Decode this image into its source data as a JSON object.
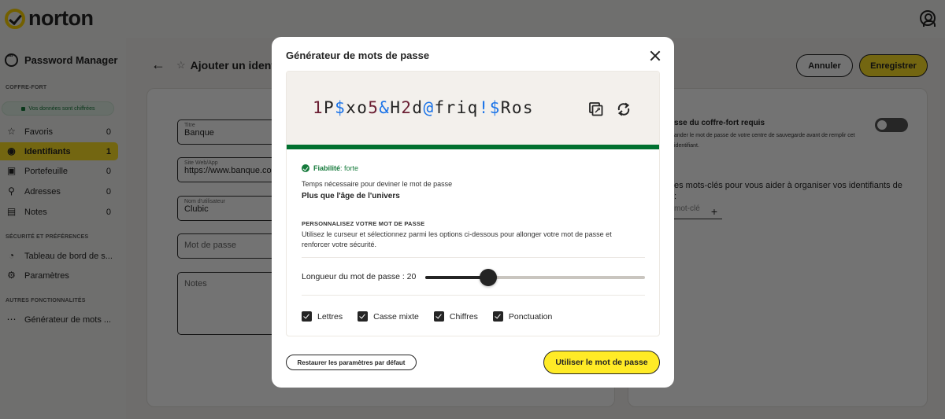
{
  "app": {
    "brand": "norton",
    "icons": {
      "logo": "norton-check-logo",
      "account": "account-circle-icon"
    }
  },
  "sidebar": {
    "title": "Password Manager",
    "sections": {
      "vault": "COFFRE-FORT",
      "security": "SÉCURITÉ ET PRÉFÉRENCES",
      "other": "AUTRES FONCTIONNALITÉS"
    },
    "encrypted_badge": "Vos données sont chiffrées",
    "vault_items": [
      {
        "label": "Favoris",
        "count": "0",
        "icon": "star-icon"
      },
      {
        "label": "Identifiants",
        "count": "1",
        "icon": "user-circle-icon",
        "active": true
      },
      {
        "label": "Portefeuille",
        "count": "0",
        "icon": "wallet-icon"
      },
      {
        "label": "Adresses",
        "count": "0",
        "icon": "location-pin-icon"
      },
      {
        "label": "Notes",
        "count": "0",
        "icon": "note-icon"
      }
    ],
    "security_items": [
      {
        "label": "Tableau de bord de s...",
        "icon": "dashboard-icon"
      },
      {
        "label": "Paramètres",
        "icon": "gear-icon"
      }
    ],
    "other_items": [
      {
        "label": "Générateur de mots ...",
        "icon": "password-generator-icon"
      }
    ]
  },
  "main": {
    "title": "Ajouter un identifi",
    "fields": {
      "title_label": "Titre",
      "title_value": "Banque",
      "site_label": "Site Web/App",
      "site_value": "https://www.banque.co",
      "user_label": "Nom d'utilisateur",
      "user_value": "Clubic",
      "password_placeholder": "Mot de passe",
      "notes_placeholder": "Notes"
    },
    "buttons": {
      "cancel": "Annuler",
      "save": "Enregistrer"
    },
    "vault_password": {
      "title": "sse du coffre-fort requis",
      "desc": "ander le mot de passe de votre centre de sauvegarde avant de remplir cet identifiant.",
      "enabled": false
    },
    "keywords": {
      "text": "es mots-clés pour vous aider à organiser vos identifiants de :",
      "placeholder": "mot-clé",
      "add": "+"
    }
  },
  "modal": {
    "title": "Générateur de mots de passe",
    "password_chars": [
      {
        "c": "1",
        "t": "digit"
      },
      {
        "c": "P",
        "t": "letter"
      },
      {
        "c": "$",
        "t": "symbol"
      },
      {
        "c": "x",
        "t": "letter"
      },
      {
        "c": "o",
        "t": "letter"
      },
      {
        "c": "5",
        "t": "digit"
      },
      {
        "c": "&",
        "t": "symbol"
      },
      {
        "c": "H",
        "t": "letter"
      },
      {
        "c": "2",
        "t": "digit"
      },
      {
        "c": "d",
        "t": "letter"
      },
      {
        "c": "@",
        "t": "symbol"
      },
      {
        "c": "f",
        "t": "letter"
      },
      {
        "c": "r",
        "t": "letter"
      },
      {
        "c": "i",
        "t": "letter"
      },
      {
        "c": "q",
        "t": "letter"
      },
      {
        "c": "!",
        "t": "symbol"
      },
      {
        "c": "$",
        "t": "symbol"
      },
      {
        "c": "R",
        "t": "letter"
      },
      {
        "c": "o",
        "t": "letter"
      },
      {
        "c": "s",
        "t": "letter"
      }
    ],
    "colors": {
      "digit": "#6b1f33",
      "symbol": "#1a73e8",
      "letter": "#242424",
      "strength": "#00702f"
    },
    "strength_label": "Fiabilité",
    "strength_value": " : forte",
    "time_label": "Temps nécessaire pour deviner le mot de passe",
    "time_value": "Plus que l'âge de l'univers",
    "custom_title": "PERSONNALISEZ VOTRE MOT DE PASSE",
    "custom_desc": "Utilisez le curseur et sélectionnez parmi les options ci-dessous pour allonger votre mot de passe et renforcer votre sécurité.",
    "length_label": "Longueur du mot de passe : 20",
    "length": {
      "value": 20,
      "fraction": 0.286
    },
    "options": [
      {
        "label": "Lettres",
        "checked": true
      },
      {
        "label": "Casse mixte",
        "checked": true
      },
      {
        "label": "Chiffres",
        "checked": true
      },
      {
        "label": "Ponctuation",
        "checked": true
      }
    ],
    "restore_button": "Restaurer les paramètres par défaut",
    "use_button": "Utiliser le mot de passe"
  }
}
